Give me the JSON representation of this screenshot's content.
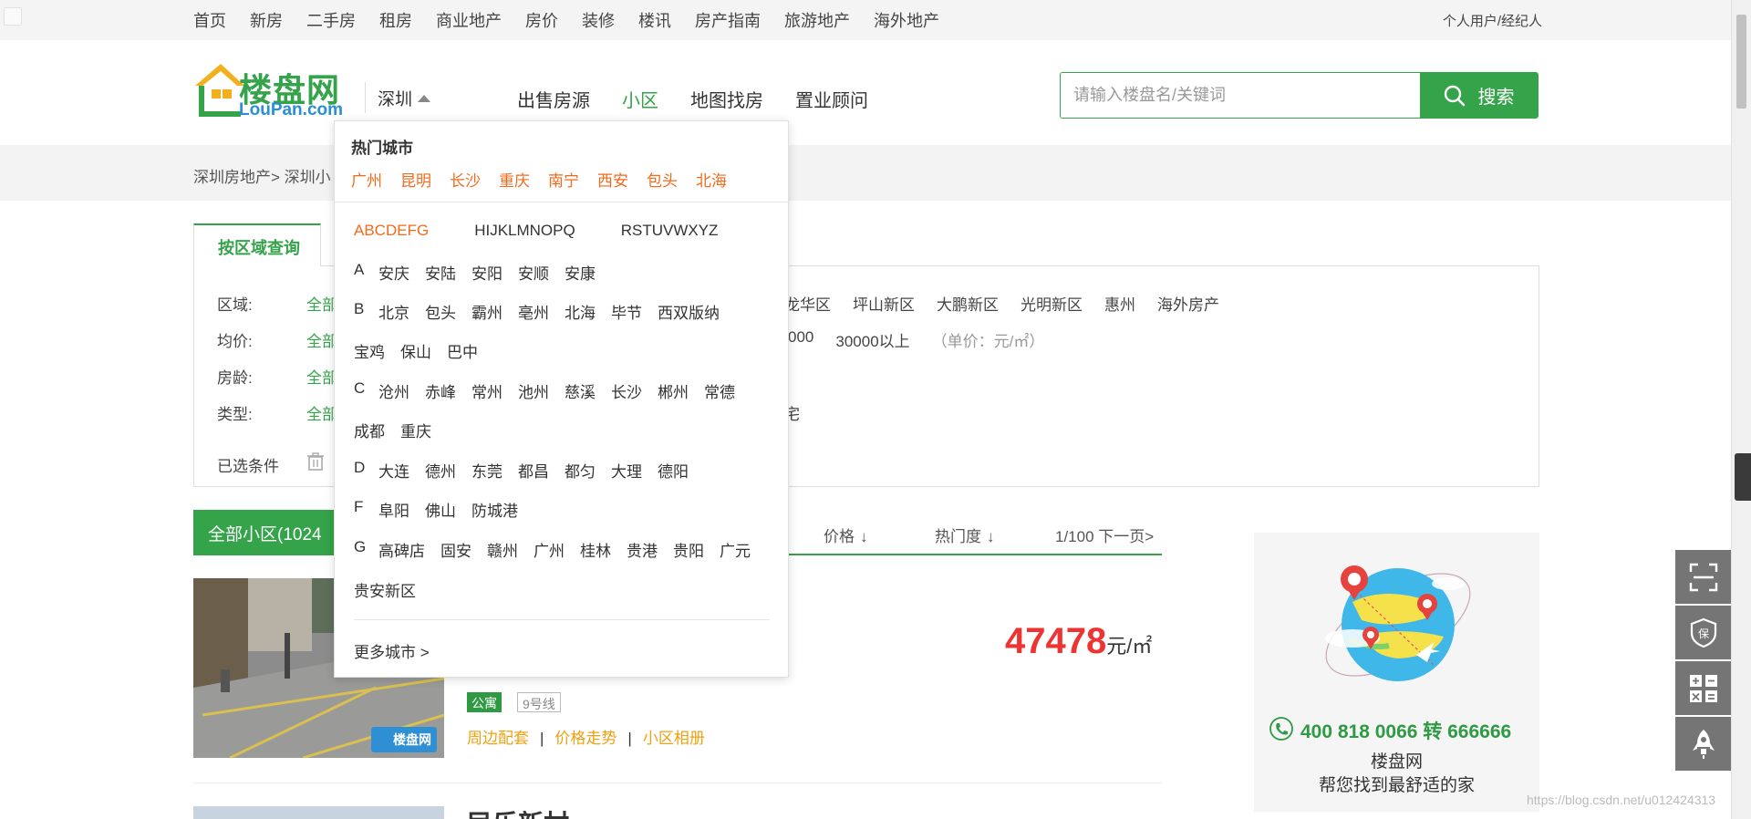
{
  "top_nav": {
    "items": [
      "首页",
      "新房",
      "二手房",
      "租房",
      "商业地产",
      "房价",
      "装修",
      "楼讯",
      "房产指南",
      "旅游地产",
      "海外地产"
    ],
    "user_link": "个人用户/经纪人"
  },
  "logo": {
    "cn": "楼盘网",
    "en": "LouPan.com"
  },
  "city_selector": {
    "current": "深圳"
  },
  "main_nav": {
    "items": [
      "出售房源",
      "小区",
      "地图找房",
      "置业顾问"
    ],
    "active_index": 1
  },
  "search": {
    "placeholder": "请输入楼盘名/关键词",
    "button_label": "搜索"
  },
  "breadcrumb": "深圳房地产> 深圳小",
  "filter": {
    "tab_label": "按区域查询",
    "rows": [
      {
        "label": "区域:",
        "all": "全部",
        "items": [
          "龙华区",
          "坪山新区",
          "大鹏新区",
          "光明新区",
          "惠州",
          "海外房产"
        ]
      },
      {
        "label": "均价:",
        "all": "全部",
        "items": [
          "000",
          "30000以上",
          "（单价：元/㎡）"
        ]
      },
      {
        "label": "房龄:",
        "all": "全部",
        "items": []
      },
      {
        "label": "类型:",
        "all": "全部",
        "items": [
          "宅"
        ]
      }
    ],
    "selected_label": "已选条件"
  },
  "list": {
    "all_label": "全部小区(1024",
    "sort": [
      {
        "label": "价格"
      },
      {
        "label": "热门度"
      }
    ],
    "pager": "1/100 下一页>"
  },
  "listing1": {
    "photo_watermark": "楼盘网",
    "price": "47478",
    "price_unit": "元/㎡",
    "tags": [
      "公寓",
      "9号线"
    ],
    "links": [
      "周边配套",
      "价格走势",
      "小区相册"
    ]
  },
  "listing2": {
    "title": "民乐新村"
  },
  "ad": {
    "phone": "400 818 0066 转 666666",
    "brand": "楼盘网",
    "slogan": "帮您找到最舒适的家"
  },
  "watermark": "https://blog.csdn.net/u012424313",
  "dropdown": {
    "hot_title": "热门城市",
    "hot_cities": [
      "广州",
      "昆明",
      "长沙",
      "重庆",
      "南宁",
      "西安",
      "包头",
      "北海"
    ],
    "letter_groups": [
      "ABCDEFG",
      "HIJKLMNOPQ",
      "RSTUVWXYZ"
    ],
    "rows": [
      {
        "letter": "A",
        "cities": [
          "安庆",
          "安陆",
          "安阳",
          "安顺",
          "安康"
        ]
      },
      {
        "letter": "B",
        "cities": [
          "北京",
          "包头",
          "霸州",
          "亳州",
          "北海",
          "毕节",
          "西双版纳"
        ]
      },
      {
        "letter": "",
        "cities": [
          "宝鸡",
          "保山",
          "巴中"
        ]
      },
      {
        "letter": "C",
        "cities": [
          "沧州",
          "赤峰",
          "常州",
          "池州",
          "慈溪",
          "长沙",
          "郴州",
          "常德"
        ]
      },
      {
        "letter": "",
        "cities": [
          "成都",
          "重庆"
        ]
      },
      {
        "letter": "D",
        "cities": [
          "大连",
          "德州",
          "东莞",
          "都昌",
          "都匀",
          "大理",
          "德阳"
        ]
      },
      {
        "letter": "F",
        "cities": [
          "阜阳",
          "佛山",
          "防城港"
        ]
      },
      {
        "letter": "G",
        "cities": [
          "高碑店",
          "固安",
          "赣州",
          "广州",
          "桂林",
          "贵港",
          "贵阳",
          "广元"
        ]
      },
      {
        "letter": "",
        "cities": [
          "贵安新区"
        ]
      }
    ],
    "more": "更多城市 >"
  },
  "colors": {
    "brand_green": "#34a34a",
    "hot_orange": "#f26a1b",
    "price_red": "#e33333",
    "link_orange": "#f0a010"
  }
}
